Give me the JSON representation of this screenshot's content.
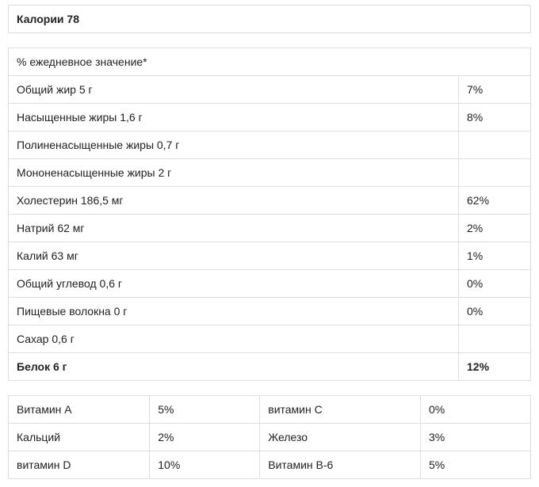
{
  "calories": {
    "label": "Калории 78"
  },
  "dailyValueHeader": "% ежедневное значение*",
  "rows": [
    {
      "label": "Общий жир 5 г",
      "pct": "7%"
    },
    {
      "label": "Насыщенные жиры 1,6 г",
      "pct": "8%"
    },
    {
      "label": "Полиненасыщенные жиры 0,7 г",
      "pct": ""
    },
    {
      "label": "Мононенасыщенные жиры 2 г",
      "pct": ""
    },
    {
      "label": "Холестерин 186,5 мг",
      "pct": "62%"
    },
    {
      "label": "Натрий 62 мг",
      "pct": "2%"
    },
    {
      "label": "Калий 63 мг",
      "pct": "1%"
    },
    {
      "label": "Общий углевод 0,6 г",
      "pct": "0%"
    },
    {
      "label": "Пищевые волокна 0 г",
      "pct": "0%"
    },
    {
      "label": "Сахар 0,6 г",
      "pct": ""
    }
  ],
  "protein": {
    "label": "Белок 6 г",
    "pct": "12%"
  },
  "vitamins": [
    {
      "name1": "Витамин А",
      "val1": "5%",
      "name2": "витамин С",
      "val2": "0%"
    },
    {
      "name1": "Кальций",
      "val1": "2%",
      "name2": "Железо",
      "val2": "3%"
    },
    {
      "name1": "витамин D",
      "val1": "10%",
      "name2": "Витамин B-6",
      "val2": "5%"
    }
  ]
}
